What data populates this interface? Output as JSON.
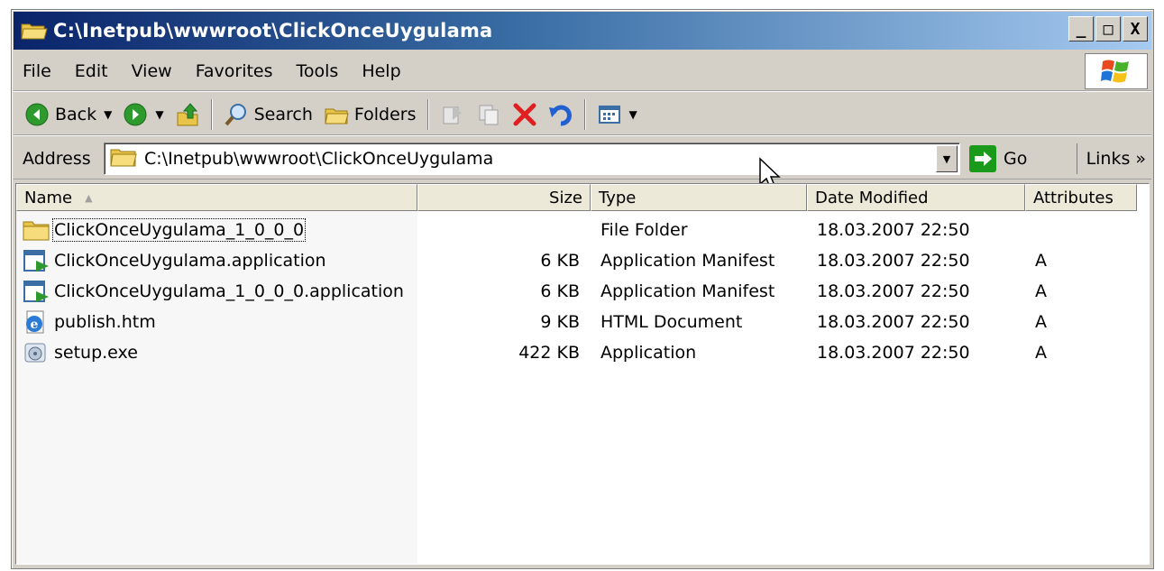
{
  "window": {
    "title": "C:\\Inetpub\\wwwroot\\ClickOnceUygulama",
    "buttons": {
      "minimize": "_",
      "maximize": "□",
      "close": "X"
    }
  },
  "menu": [
    "File",
    "Edit",
    "View",
    "Favorites",
    "Tools",
    "Help"
  ],
  "toolbar": {
    "back_label": "Back",
    "search_label": "Search",
    "folders_label": "Folders"
  },
  "address": {
    "label": "Address",
    "value": "C:\\Inetpub\\wwwroot\\ClickOnceUygulama",
    "go_label": "Go",
    "links_label": "Links",
    "links_chevron": "»"
  },
  "columns": {
    "name": "Name",
    "size": "Size",
    "type": "Type",
    "date": "Date Modified",
    "attributes": "Attributes"
  },
  "files": [
    {
      "name": "ClickOnceUygulama_1_0_0_0",
      "size": "",
      "type": "File Folder",
      "date": "18.03.2007 22:50",
      "attr": "",
      "icon": "folder-icon"
    },
    {
      "name": "ClickOnceUygulama.application",
      "size": "6 KB",
      "type": "Application Manifest",
      "date": "18.03.2007 22:50",
      "attr": "A",
      "icon": "manifest-icon"
    },
    {
      "name": "ClickOnceUygulama_1_0_0_0.application",
      "size": "6 KB",
      "type": "Application Manifest",
      "date": "18.03.2007 22:50",
      "attr": "A",
      "icon": "manifest-icon"
    },
    {
      "name": "publish.htm",
      "size": "9 KB",
      "type": "HTML Document",
      "date": "18.03.2007 22:50",
      "attr": "A",
      "icon": "ie-document-icon"
    },
    {
      "name": "setup.exe",
      "size": "422 KB",
      "type": "Application",
      "date": "18.03.2007 22:50",
      "attr": "A",
      "icon": "setup-exe-icon"
    }
  ],
  "colors": {
    "title_start": "#0a246a",
    "title_end": "#a6caf0",
    "chrome": "#d4d0c8"
  }
}
